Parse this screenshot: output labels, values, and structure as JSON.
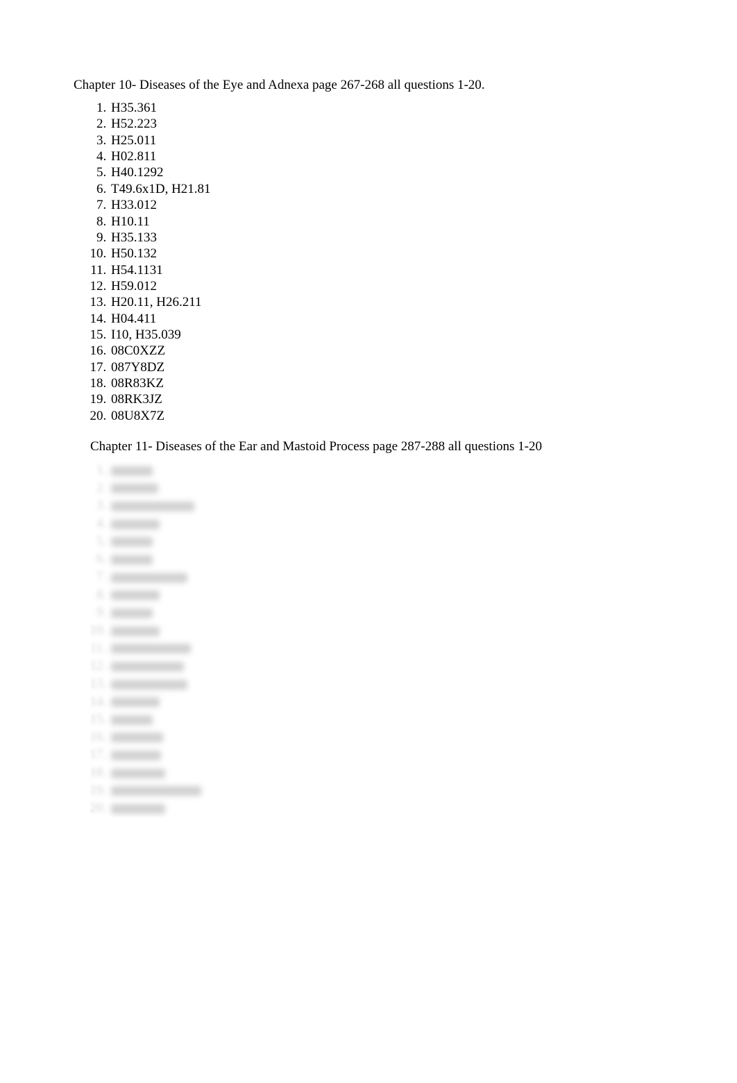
{
  "section1": {
    "title": "Chapter 10- Diseases of the Eye and Adnexa page 267-268 all questions 1-20.",
    "items": [
      "H35.361",
      "H52.223",
      "H25.011",
      "H02.811",
      "H40.1292",
      "T49.6x1D, H21.81",
      "H33.012",
      "H10.11",
      "H35.133",
      "H50.132",
      "H54.1131",
      "H59.012",
      "H20.11, H26.211",
      "H04.411",
      "I10, H35.039",
      "08C0XZZ",
      "087Y8DZ",
      "08R83KZ",
      "08RK3JZ",
      "08U8X7Z"
    ]
  },
  "section2": {
    "title": "Chapter 11- Diseases of the Ear and Mastoid Process page 287-288 all questions 1-20",
    "items_blurred_widths": [
      60,
      68,
      120,
      70,
      60,
      60,
      110,
      70,
      60,
      70,
      115,
      105,
      110,
      70,
      60,
      75,
      72,
      78,
      130,
      78
    ]
  }
}
